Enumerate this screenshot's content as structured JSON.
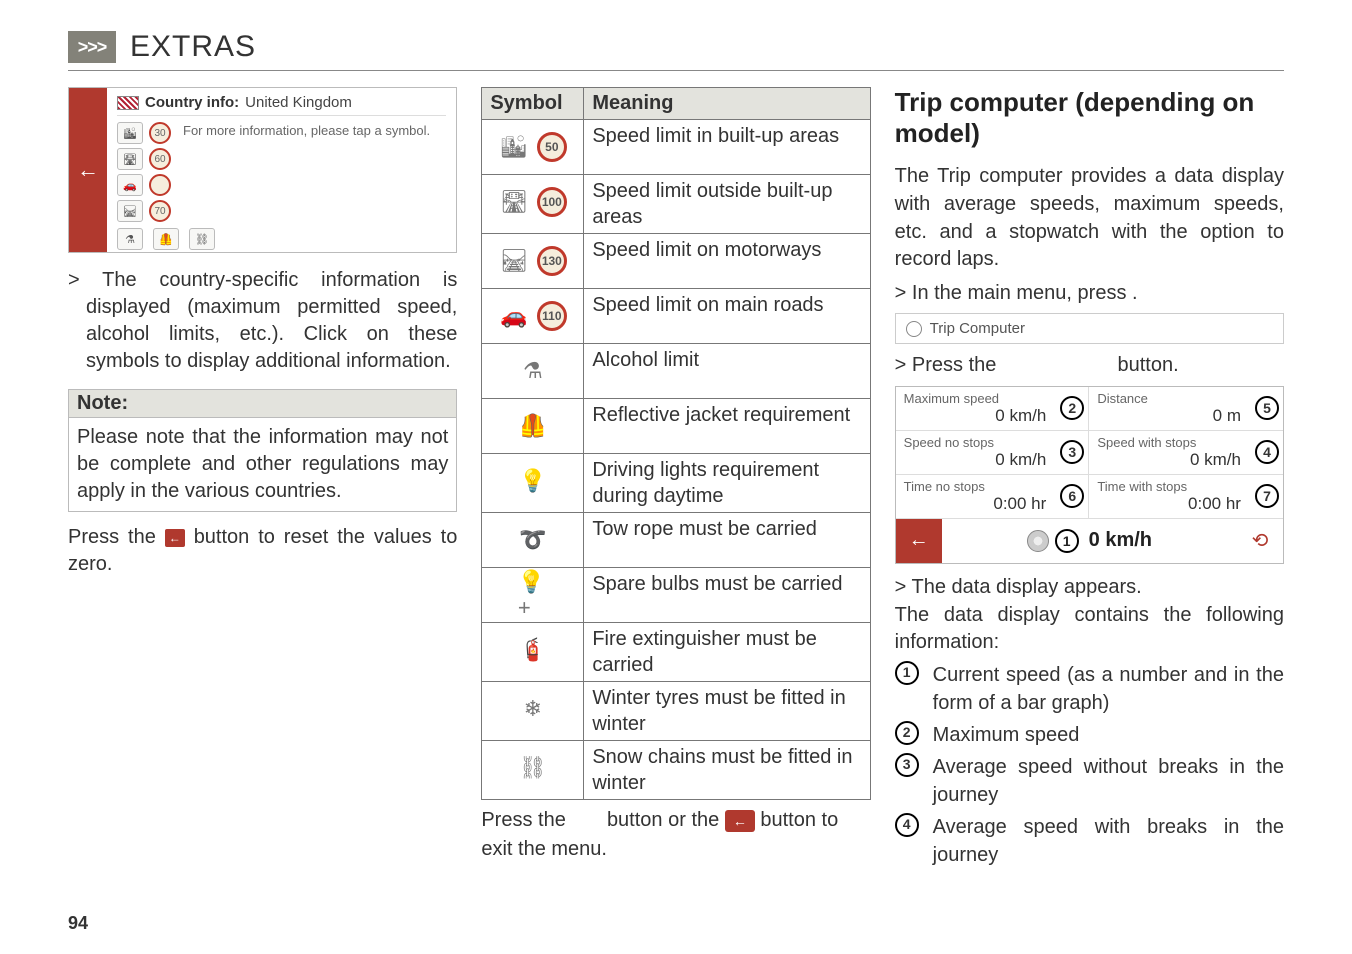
{
  "header": {
    "chevrons": ">>>",
    "title": "EXTRAS"
  },
  "col1": {
    "country_info_label": "Country info:",
    "country_info_value": "United Kingdom",
    "tap_hint": "For more information, please tap a symbol.",
    "speed_values": [
      "30",
      "60",
      "",
      "70"
    ],
    "bullet": "> The country-specific information is displayed (maximum permitted speed, alcohol limits, etc.). Click on these symbols to display additional information.",
    "note_label": "Note:",
    "note_body": "Please note that the information may not be complete and other regulations may apply in the various countries.",
    "reset_pre": "Press the ",
    "reset_post": " button to reset the values to zero."
  },
  "table": {
    "head_symbol": "Symbol",
    "head_meaning": "Meaning",
    "rows": [
      {
        "circle": "50",
        "icon": "🏙",
        "meaning": "Speed limit in built-up areas"
      },
      {
        "circle": "100",
        "icon": "🛣",
        "meaning": "Speed limit outside built-up areas"
      },
      {
        "circle": "130",
        "icon": "🛤",
        "meaning": "Speed limit on motorways"
      },
      {
        "circle": "110",
        "icon": "🚗",
        "meaning": "Speed limit on main roads"
      },
      {
        "circle": "",
        "icon": "⚗",
        "meaning": "Alcohol limit"
      },
      {
        "circle": "",
        "icon": "🦺",
        "meaning": "Reflective jacket requirement"
      },
      {
        "circle": "",
        "icon": "💡",
        "meaning": "Driving lights requirement during daytime"
      },
      {
        "circle": "",
        "icon": "➰",
        "meaning": "Tow rope must be carried"
      },
      {
        "circle": "",
        "icon": "💡+",
        "meaning": "Spare bulbs must be carried"
      },
      {
        "circle": "",
        "icon": "🧯",
        "meaning": "Fire extinguisher must be carried"
      },
      {
        "circle": "",
        "icon": "❄",
        "meaning": "Winter tyres must be fitted in winter"
      },
      {
        "circle": "",
        "icon": "⛓",
        "meaning": "Snow chains must be fitted in winter"
      }
    ],
    "foot_pre": "Press the ",
    "foot_mid": " button or the ",
    "foot_post": " button to exit the menu."
  },
  "col3": {
    "heading": "Trip computer (depending on model)",
    "intro": "The Trip computer provides a data display with average speeds, maximum speeds, etc. and a stopwatch with the option to record laps.",
    "step1": "> In the main menu, press             .",
    "trip_title": "Trip Computer",
    "step2_pre": "> Press the ",
    "step2_post": " button.",
    "cells": [
      {
        "label": "Maximum speed",
        "value": "0 km/h",
        "callout": "2"
      },
      {
        "label": "Distance",
        "value": "0 m",
        "callout": "5"
      },
      {
        "label": "Speed no stops",
        "value": "0 km/h",
        "callout": "3"
      },
      {
        "label": "Speed with stops",
        "value": "0 km/h",
        "callout": "4"
      },
      {
        "label": "Time no stops",
        "value": "0:00 hr",
        "callout": "6"
      },
      {
        "label": "Time with stops",
        "value": "0:00 hr",
        "callout": "7"
      }
    ],
    "bottom_speed": "0 km/h",
    "bottom_callout": "1",
    "after1": "> The data display appears.",
    "after2": "The data display contains the following information:",
    "items": [
      {
        "n": "1",
        "t": "Current speed (as a number and in the form of a bar graph)"
      },
      {
        "n": "2",
        "t": "Maximum speed"
      },
      {
        "n": "3",
        "t": "Average speed without breaks in the journey"
      },
      {
        "n": "4",
        "t": "Average speed with breaks in the journey"
      }
    ]
  },
  "page_number": "94"
}
